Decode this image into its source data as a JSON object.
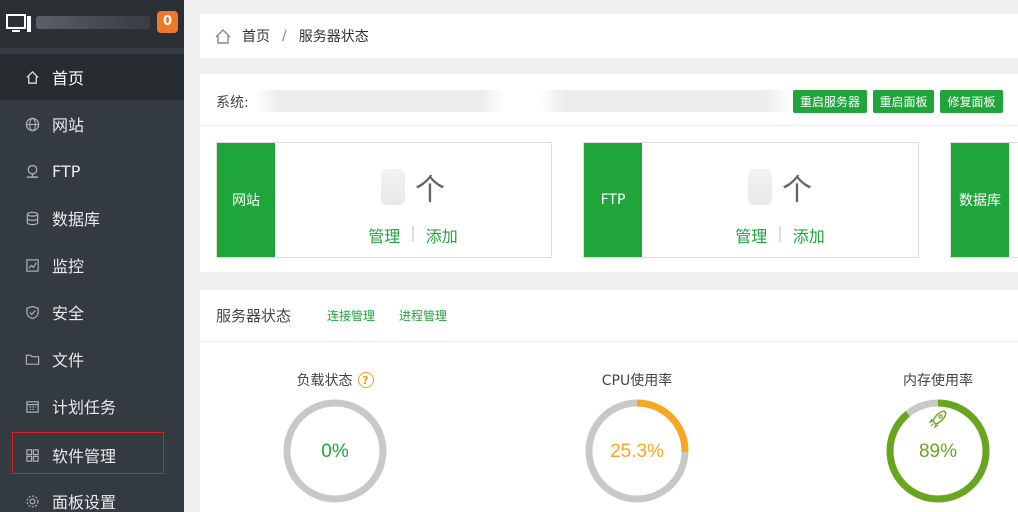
{
  "sidebar": {
    "badge": "0",
    "items": [
      {
        "label": "首页",
        "icon": "home-icon",
        "active": true
      },
      {
        "label": "网站",
        "icon": "globe-icon"
      },
      {
        "label": "FTP",
        "icon": "ftp-icon"
      },
      {
        "label": "数据库",
        "icon": "database-icon"
      },
      {
        "label": "监控",
        "icon": "monitor-chart-icon"
      },
      {
        "label": "安全",
        "icon": "shield-icon"
      },
      {
        "label": "文件",
        "icon": "folder-icon"
      },
      {
        "label": "计划任务",
        "icon": "calendar-icon"
      },
      {
        "label": "软件管理",
        "icon": "grid-icon",
        "highlighted": true
      },
      {
        "label": "面板设置",
        "icon": "gear-icon"
      }
    ]
  },
  "breadcrumb": {
    "home": "首页",
    "sep": "/",
    "current": "服务器状态"
  },
  "system": {
    "label": "系统:",
    "buttons": {
      "restart_server": "重启服务器",
      "restart_panel": "重启面板",
      "repair_panel": "修复面板"
    }
  },
  "cards": [
    {
      "tag": "网站",
      "unit": "个",
      "manage": "管理",
      "add": "添加"
    },
    {
      "tag": "FTP",
      "unit": "个",
      "manage": "管理",
      "add": "添加"
    },
    {
      "tag": "数据库"
    }
  ],
  "status": {
    "title": "服务器状态",
    "link_connections": "连接管理",
    "link_processes": "进程管理",
    "gauges": [
      {
        "title": "负载状态",
        "value_text": "0%",
        "percent": 0,
        "color": "#20a53a",
        "help": "?"
      },
      {
        "title": "CPU使用率",
        "value_text": "25.3%",
        "percent": 25.3,
        "color": "#f7a823"
      },
      {
        "title": "内存使用率",
        "value_text": "89%",
        "percent": 89,
        "color": "#6aa520"
      }
    ]
  },
  "colors": {
    "accent": "#20a53a",
    "sidebar_bg": "#333a40",
    "badge": "#f0782a"
  }
}
